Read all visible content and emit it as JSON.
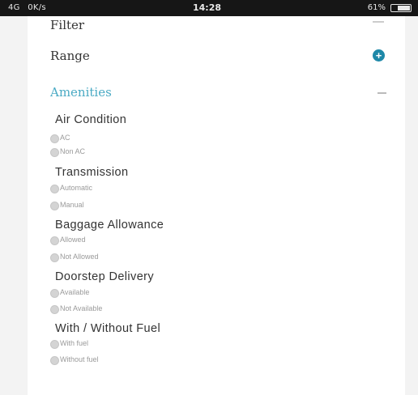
{
  "status_bar": {
    "network": "4G",
    "speed": "0K/s",
    "extras": "",
    "time": "14:28",
    "battery": "61%"
  },
  "filter": {
    "title": "Filter"
  },
  "range": {
    "label": "Range",
    "toggle": "+"
  },
  "amenities": {
    "label": "Amenities"
  },
  "groups": [
    {
      "title": "Air Condition",
      "options": [
        "AC",
        "Non AC"
      ]
    },
    {
      "title": "Transmission",
      "options": [
        "Automatic",
        "Manual"
      ]
    },
    {
      "title": "Baggage Allowance",
      "options": [
        "Allowed",
        "Not Allowed"
      ]
    },
    {
      "title": "Doorstep Delivery",
      "options": [
        "Available",
        "Not Available"
      ]
    },
    {
      "title": "With / Without Fuel",
      "options": [
        "With fuel",
        "Without fuel"
      ]
    }
  ],
  "colors": {
    "accent": "#1e88a8",
    "section_link": "#4aaac4",
    "status_bar": "#161616"
  }
}
